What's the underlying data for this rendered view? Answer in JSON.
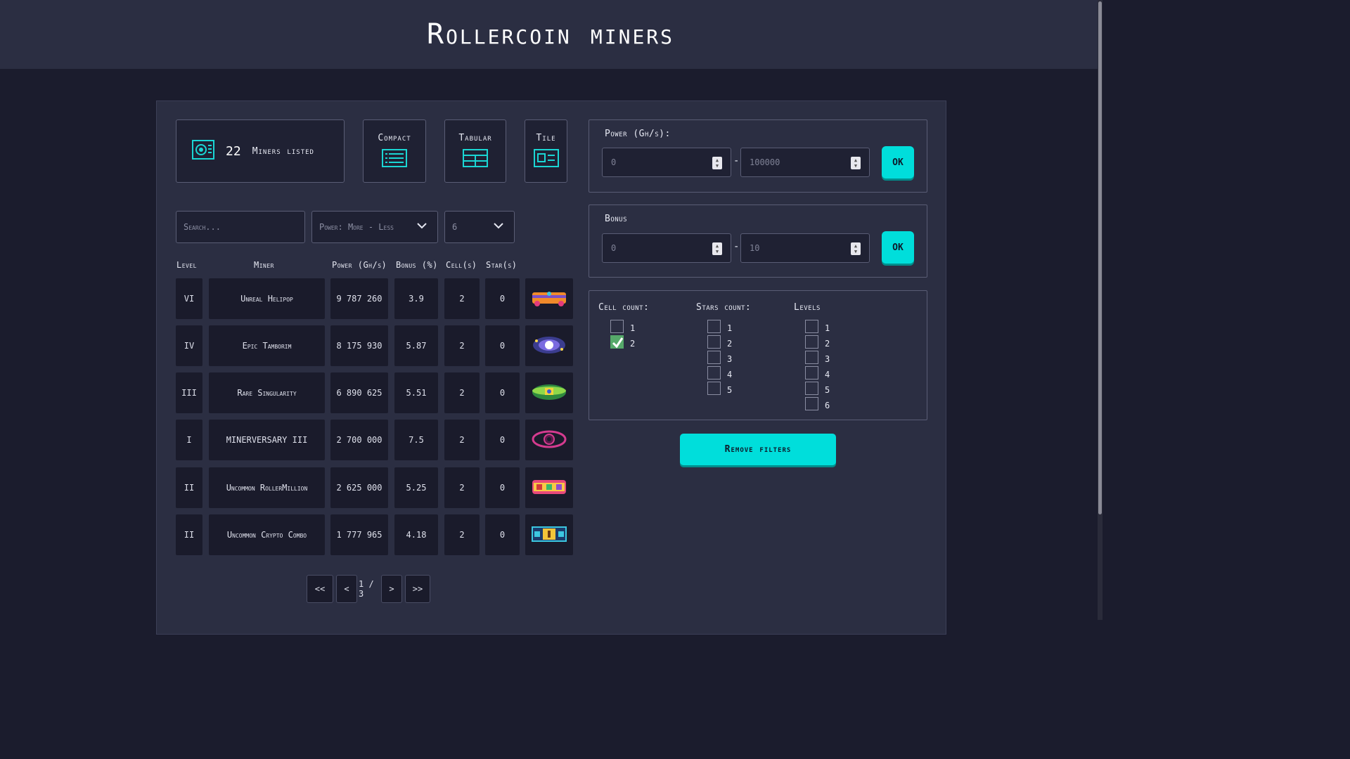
{
  "header": {
    "title": "Rollercoin miners"
  },
  "summary": {
    "count": "22",
    "label": "Miners listed"
  },
  "views": {
    "compact": "Compact",
    "tabular": "Tabular",
    "tile": "Tile"
  },
  "controls": {
    "search_placeholder": "Search...",
    "sort_value": "Power: More - Less",
    "per_page_value": "6"
  },
  "table": {
    "headers": {
      "level": "Level",
      "miner": "Miner",
      "power": "Power (Gh/s)",
      "bonus": "Bonus (%)",
      "cells": "Cell(s)",
      "stars": "Star(s)"
    },
    "rows": [
      {
        "level": "VI",
        "miner": "Unreal Helipop",
        "power": "9 787 260",
        "bonus": "3.9",
        "cells": "2",
        "stars": "0",
        "image": "helipop-icon"
      },
      {
        "level": "IV",
        "miner": "Epic Tamborim",
        "power": "8 175 930",
        "bonus": "5.87",
        "cells": "2",
        "stars": "0",
        "image": "tamborim-icon"
      },
      {
        "level": "III",
        "miner": "Rare Singularity",
        "power": "6 890 625",
        "bonus": "5.51",
        "cells": "2",
        "stars": "0",
        "image": "singularity-icon"
      },
      {
        "level": "I",
        "miner": "MINERVERSARY III",
        "power": "2 700 000",
        "bonus": "7.5",
        "cells": "2",
        "stars": "0",
        "image": "minerversary-icon"
      },
      {
        "level": "II",
        "miner": "Uncommon RollerMillion",
        "power": "2 625 000",
        "bonus": "5.25",
        "cells": "2",
        "stars": "0",
        "image": "rollermillion-icon"
      },
      {
        "level": "II",
        "miner": "Uncommon Crypto Combo",
        "power": "1 777 965",
        "bonus": "4.18",
        "cells": "2",
        "stars": "0",
        "image": "crypto-combo-icon"
      }
    ]
  },
  "pagination": {
    "first": "<<",
    "prev": "<",
    "page": "1 / 3",
    "next": ">",
    "last": ">>"
  },
  "filters": {
    "power": {
      "title": "Power (Gh/s):",
      "min": "0",
      "max": "100000",
      "ok": "OK"
    },
    "bonus": {
      "title": "Bonus",
      "min": "0",
      "max": "10",
      "ok": "OK"
    },
    "cell_count": {
      "title": "Cell count:",
      "options": [
        "1",
        "2"
      ],
      "checked": [
        "2"
      ]
    },
    "stars_count": {
      "title": "Stars count:",
      "options": [
        "1",
        "2",
        "3",
        "4",
        "5"
      ]
    },
    "levels": {
      "title": "Levels",
      "options": [
        "1",
        "2",
        "3",
        "4",
        "5",
        "6"
      ]
    },
    "remove": "Remove filters"
  },
  "colors": {
    "accent": "#00dedb",
    "check": "#56a96a",
    "panel": "#2b2e42",
    "background": "#1b1c2d"
  }
}
